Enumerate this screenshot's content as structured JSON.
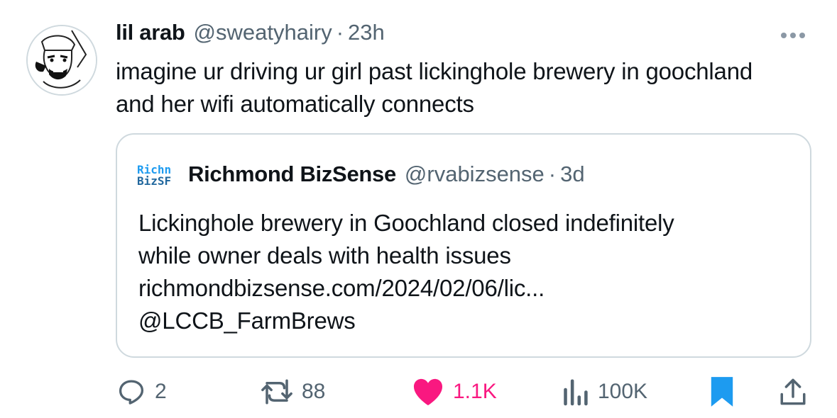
{
  "tweet": {
    "author_name": "lil arab",
    "author_handle": "@sweatyhairy",
    "separator": "·",
    "time": "23h",
    "text": "imagine ur driving ur girl past lickinghole brewery in goochland and her wifi automatically connects"
  },
  "quote": {
    "logo_text_line1": "Richn",
    "logo_text_line2": "BizSF",
    "author_name": "Richmond BizSense",
    "author_handle": "@rvabizsense",
    "separator": "·",
    "time": "3d",
    "text_lines": [
      "Lickinghole brewery in Goochland closed indefinitely",
      "while owner deals with health issues",
      "richmondbizsense.com/2024/02/06/lic...",
      "@LCCB_FarmBrews"
    ]
  },
  "actions": {
    "replies": "2",
    "reposts": "88",
    "likes": "1.1K",
    "views": "100K"
  },
  "icons": {
    "more": "more-dots-icon",
    "reply": "reply-bubble-icon",
    "repost": "repost-arrows-icon",
    "like": "heart-icon",
    "views": "bar-chart-icon",
    "bookmark": "bookmark-icon",
    "share": "share-icon"
  },
  "colors": {
    "text": "#0f1419",
    "secondary": "#536471",
    "like": "#f91880",
    "bookmark": "#1d9bf0",
    "border": "#cfd9de"
  }
}
